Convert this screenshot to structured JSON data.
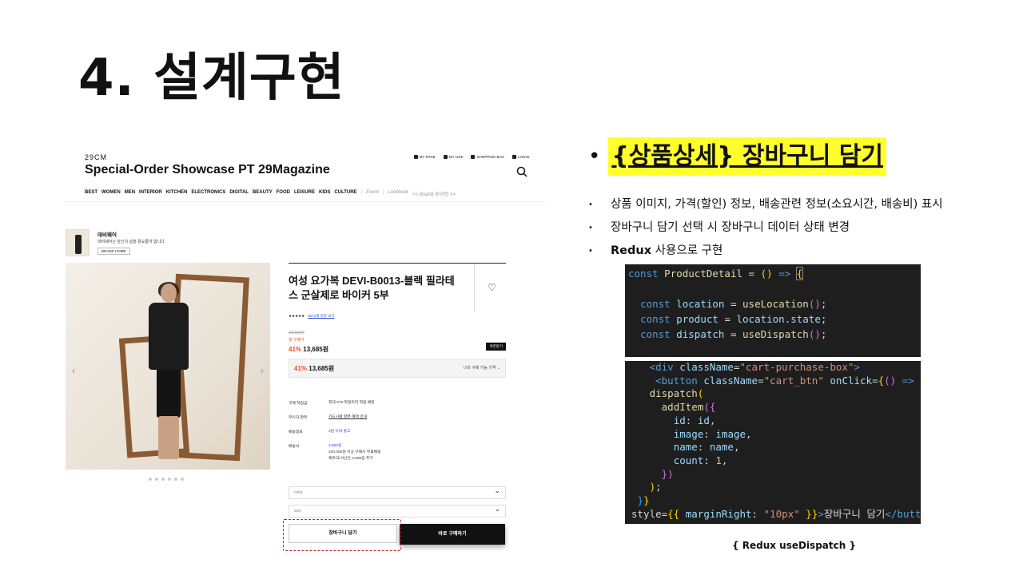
{
  "slide": {
    "title": "4. 설계구현"
  },
  "shop": {
    "top_label": "29CM",
    "brand": "Special-Order  Showcase  PT  29Magazine",
    "util": [
      "MY PAGE",
      "MY LIKE",
      "SHOPPING BAG",
      "LOGIN"
    ],
    "gnb": [
      "BEST",
      "WOMEN",
      "MEN",
      "INTERIOR",
      "KITCHEN",
      "ELECTRONICS",
      "DIGITAL",
      "BEAUTY",
      "FOOD",
      "LEISURE",
      "KIDS",
      "CULTURE"
    ],
    "gnb_extra": [
      "Event",
      "Lookbook",
      "<< Board(게시판) >>"
    ],
    "brand_section": {
      "title": "데비웨어",
      "desc": "데비웨어는 당신의 삶을 풍요롭게 합니다.",
      "button": "BRAND HOME"
    },
    "product": {
      "title": "여성 요가복 DEVI-B0013-블랙 필라테스 군살제로 바이커 5부",
      "stars": "★★★★★",
      "reviews": "5073개 리뷰 보기",
      "original_price": "23,195원",
      "first_label": "첫 구매가",
      "discount": "41%",
      "price": "13,685원",
      "coupon": "쿠폰받기",
      "my_price_label": "나의 구매 가능 가격"
    },
    "info": [
      {
        "k": "구매 적립금",
        "v": "최대 670 마일리지 적립 예정"
      },
      {
        "k": "무이자 할부",
        "v": "카드사별 할부 혜택 안내"
      },
      {
        "k": "배송정보",
        "v": "3일 이내 출고"
      },
      {
        "k": "배송비",
        "v": "3,500원"
      }
    ],
    "shipping_note1": "100,000원 이상 구매시 무료배송",
    "shipping_note2": "제주/도서산간 3,000원 추가",
    "select_color": "color",
    "select_size": "size",
    "cart_button": "장바구니 담기",
    "buy_button": "바로 구매하기"
  },
  "right": {
    "heading": "{상품상세} 장바구니 담기",
    "bullets": [
      "상품 이미지, 가격(할인) 정보, 배송관련 정보(소요시간, 배송비) 표시",
      "장바구니 담기 선택 시 장바구니 데이터 상태 변경"
    ],
    "bullet3_bold": "Redux",
    "bullet3_rest": " 사용으로 구현",
    "caption": "{ Redux useDispatch }"
  },
  "colors": {
    "highlight": "#ffff2b",
    "accent": "#e5502a",
    "dashed": "#c0252b",
    "code_bg": "#1e1e1e"
  }
}
